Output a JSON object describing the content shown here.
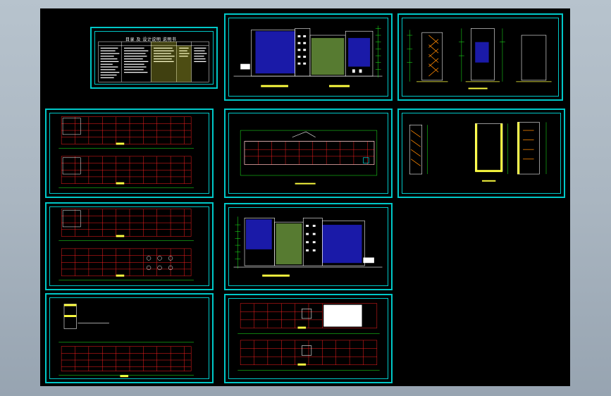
{
  "viewer": {
    "background_color": "#000000",
    "frame_color": "#00c8c8",
    "line_colors": {
      "grid_red": "#ff2020",
      "dimension_green": "#20ff20",
      "wall_white": "#ffffff",
      "glass_blue": "#1a1aa8",
      "column_yellow": "#ffff40",
      "stair_orange": "#ff8800",
      "cyan": "#00ffff"
    }
  },
  "sheets": {
    "index_table": {
      "title": "目录 及 设计说明 说明书"
    },
    "front_elevation": {},
    "side_elevations": {},
    "floor_plans_a": {},
    "site_plan": {},
    "wall_sections": {},
    "floor_plans_b": {},
    "rear_elevation": {},
    "floor_plans_c": {},
    "floor_plans_d": {}
  }
}
